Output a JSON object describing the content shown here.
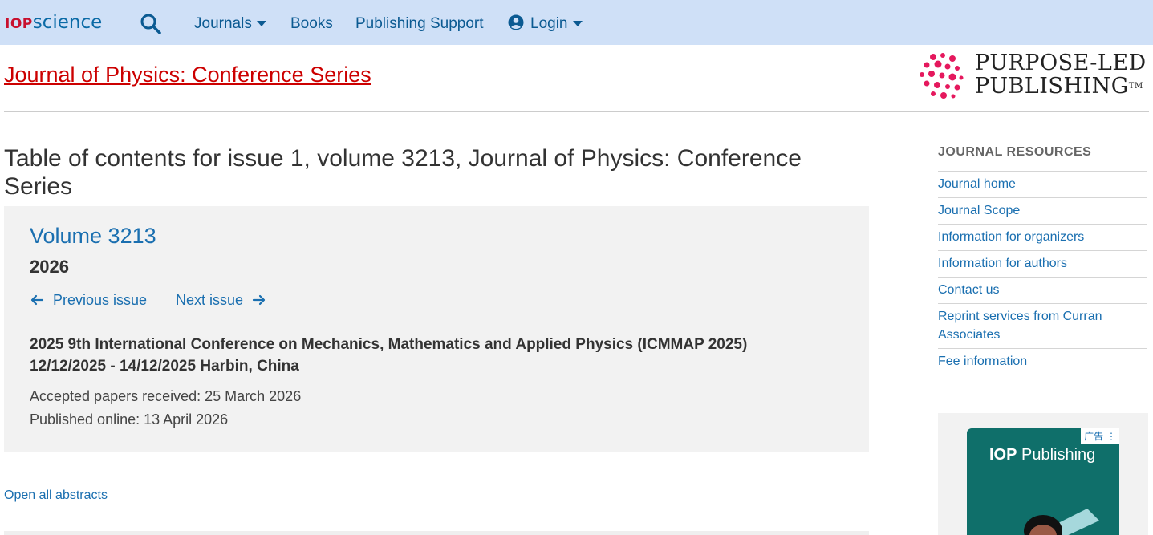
{
  "nav": {
    "logo_iop": "IOP",
    "logo_science": "science",
    "journals": "Journals",
    "books": "Books",
    "publishing_support": "Publishing Support",
    "login": "Login"
  },
  "header": {
    "journal_title": "Journal of Physics: Conference Series",
    "purpose_line1": "PURPOSE-LED",
    "purpose_line2": "PUBLISHING",
    "purpose_tm": "TM"
  },
  "main": {
    "heading": "Table of contents for issue 1, volume 3213, Journal of Physics: Conference Series",
    "volume": "Volume 3213",
    "year": "2026",
    "previous_issue": "Previous issue",
    "next_issue": "Next issue",
    "conference_title": "2025 9th International Conference on Mechanics, Mathematics and Applied Physics (ICMMAP 2025)",
    "conference_dates": "12/12/2025 - 14/12/2025 Harbin, China",
    "accepted": "Accepted papers received: 25 March 2026",
    "published": "Published online: 13 April 2026",
    "open_abstracts": "Open all abstracts"
  },
  "sidebar": {
    "heading": "JOURNAL RESOURCES",
    "items": [
      {
        "label": "Journal home"
      },
      {
        "label": "Journal Scope"
      },
      {
        "label": "Information for organizers"
      },
      {
        "label": "Information for authors"
      },
      {
        "label": "Contact us"
      },
      {
        "label": "Reprint services from Curran Associates"
      },
      {
        "label": "Fee information"
      }
    ]
  },
  "ad": {
    "label": "广告",
    "brand_bold": "IOP",
    "brand_rest": " Publishing"
  },
  "colors": {
    "nav_bg": "#cfe0f7",
    "journal_title": "#cc0000",
    "link": "#1a6fb0",
    "ad_bg": "#0f6f6a"
  }
}
